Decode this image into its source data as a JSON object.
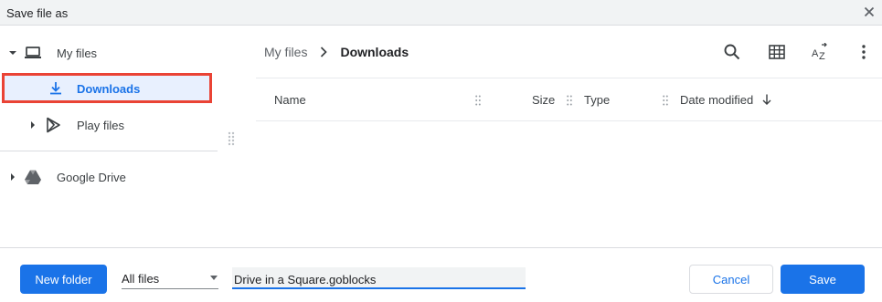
{
  "window": {
    "title": "Save file as",
    "close_icon": "close-icon"
  },
  "sidebar": {
    "my_files": {
      "label": "My files",
      "icon": "laptop-icon"
    },
    "downloads": {
      "label": "Downloads",
      "icon": "download-icon"
    },
    "play_files": {
      "label": "Play files",
      "icon": "play-store-icon"
    },
    "google_drive": {
      "label": "Google Drive",
      "icon": "google-drive-icon"
    }
  },
  "breadcrumb": {
    "root": "My files",
    "current": "Downloads"
  },
  "toolbar": {
    "icons": [
      "search-icon",
      "grid-view-icon",
      "sort-az-icon",
      "more-vert-icon"
    ]
  },
  "columns": {
    "name": "Name",
    "size": "Size",
    "type": "Type",
    "date_modified": "Date modified"
  },
  "footer": {
    "new_folder_label": "New folder",
    "filter_value": "All files",
    "filename_value": "Drive in a Square.goblocks",
    "cancel_label": "Cancel",
    "save_label": "Save"
  },
  "colors": {
    "accent": "#1a73e8",
    "highlight_box": "#ea4335",
    "selected_bg": "#e8f0fe"
  }
}
